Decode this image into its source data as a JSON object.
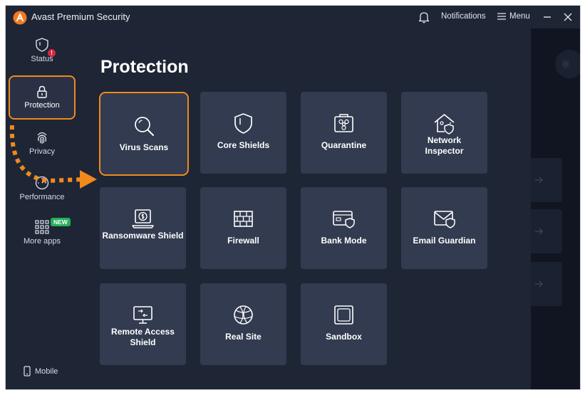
{
  "titlebar": {
    "app_title": "Avast Premium Security",
    "notifications_label": "Notifications",
    "menu_label": "Menu"
  },
  "sidebar": {
    "items": [
      {
        "label": "Status",
        "icon": "shield-alert-icon"
      },
      {
        "label": "Protection",
        "icon": "lock-icon"
      },
      {
        "label": "Privacy",
        "icon": "fingerprint-icon"
      },
      {
        "label": "Performance",
        "icon": "speedometer-icon"
      },
      {
        "label": "More apps",
        "icon": "apps-grid-icon",
        "badge": "NEW"
      }
    ],
    "mobile_label": "Mobile",
    "status_alert": "!"
  },
  "main": {
    "title": "Protection",
    "tiles": [
      {
        "label": "Virus Scans",
        "icon": "magnifier-icon"
      },
      {
        "label": "Core Shields",
        "icon": "shield-icon"
      },
      {
        "label": "Quarantine",
        "icon": "biohazard-box-icon"
      },
      {
        "label": "Network Inspector",
        "icon": "home-shield-icon"
      },
      {
        "label": "Ransomware Shield",
        "icon": "laptop-dollar-icon"
      },
      {
        "label": "Firewall",
        "icon": "brick-wall-icon"
      },
      {
        "label": "Bank Mode",
        "icon": "card-shield-icon"
      },
      {
        "label": "Email Guardian",
        "icon": "envelope-shield-icon"
      },
      {
        "label": "Remote Access Shield",
        "icon": "remote-screen-icon"
      },
      {
        "label": "Real Site",
        "icon": "globe-icon"
      },
      {
        "label": "Sandbox",
        "icon": "sandbox-icon"
      }
    ]
  },
  "colors": {
    "background": "#1e2535",
    "tile": "#323b4f",
    "highlight": "#f08a1c",
    "badge": "#23b15a",
    "alert": "#d7283f"
  }
}
